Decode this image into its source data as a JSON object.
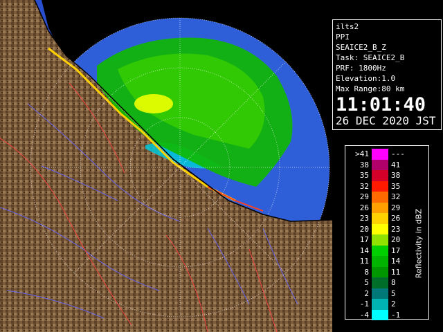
{
  "info": {
    "site": "ilts2",
    "product": "PPI",
    "scan": "SEAICE2_B_Z",
    "task": "Task: SEAICE2_B",
    "prf": "PRF: 1800Hz",
    "elevation": "Elevation:1.0",
    "max_range": "Max Range:80 km",
    "time": "11:01:40",
    "date": "26 DEC 2020 JST"
  },
  "legend": {
    "unit": "Reflectivity in dBZ",
    "rows": [
      {
        "low": ">41",
        "high": "---",
        "color": "#ff00ff"
      },
      {
        "low": "38",
        "high": "41",
        "color": "#b0006a"
      },
      {
        "low": "35",
        "high": "38",
        "color": "#d4002a"
      },
      {
        "low": "32",
        "high": "35",
        "color": "#ff1a00"
      },
      {
        "low": "29",
        "high": "32",
        "color": "#ff6a00"
      },
      {
        "low": "26",
        "high": "29",
        "color": "#ffa000"
      },
      {
        "low": "23",
        "high": "26",
        "color": "#ffd200"
      },
      {
        "low": "20",
        "high": "23",
        "color": "#ffff00"
      },
      {
        "low": "17",
        "high": "20",
        "color": "#90e000"
      },
      {
        "low": "14",
        "high": "17",
        "color": "#00d000"
      },
      {
        "low": "11",
        "high": "14",
        "color": "#00b400"
      },
      {
        "low": "8",
        "high": "11",
        "color": "#009600"
      },
      {
        "low": "5",
        "high": "8",
        "color": "#006e28"
      },
      {
        "low": "2",
        "high": "5",
        "color": "#007878"
      },
      {
        "low": "-1",
        "high": "2",
        "color": "#00b4b4"
      },
      {
        "low": "-4",
        "high": "-1",
        "color": "#00ffff"
      }
    ]
  },
  "colors": {
    "sea": "#1a5cff",
    "outer_sea": "#2f5fd8",
    "land": "#7a5a38",
    "rivers": "#5a5aff",
    "borders": "#ff4040"
  }
}
